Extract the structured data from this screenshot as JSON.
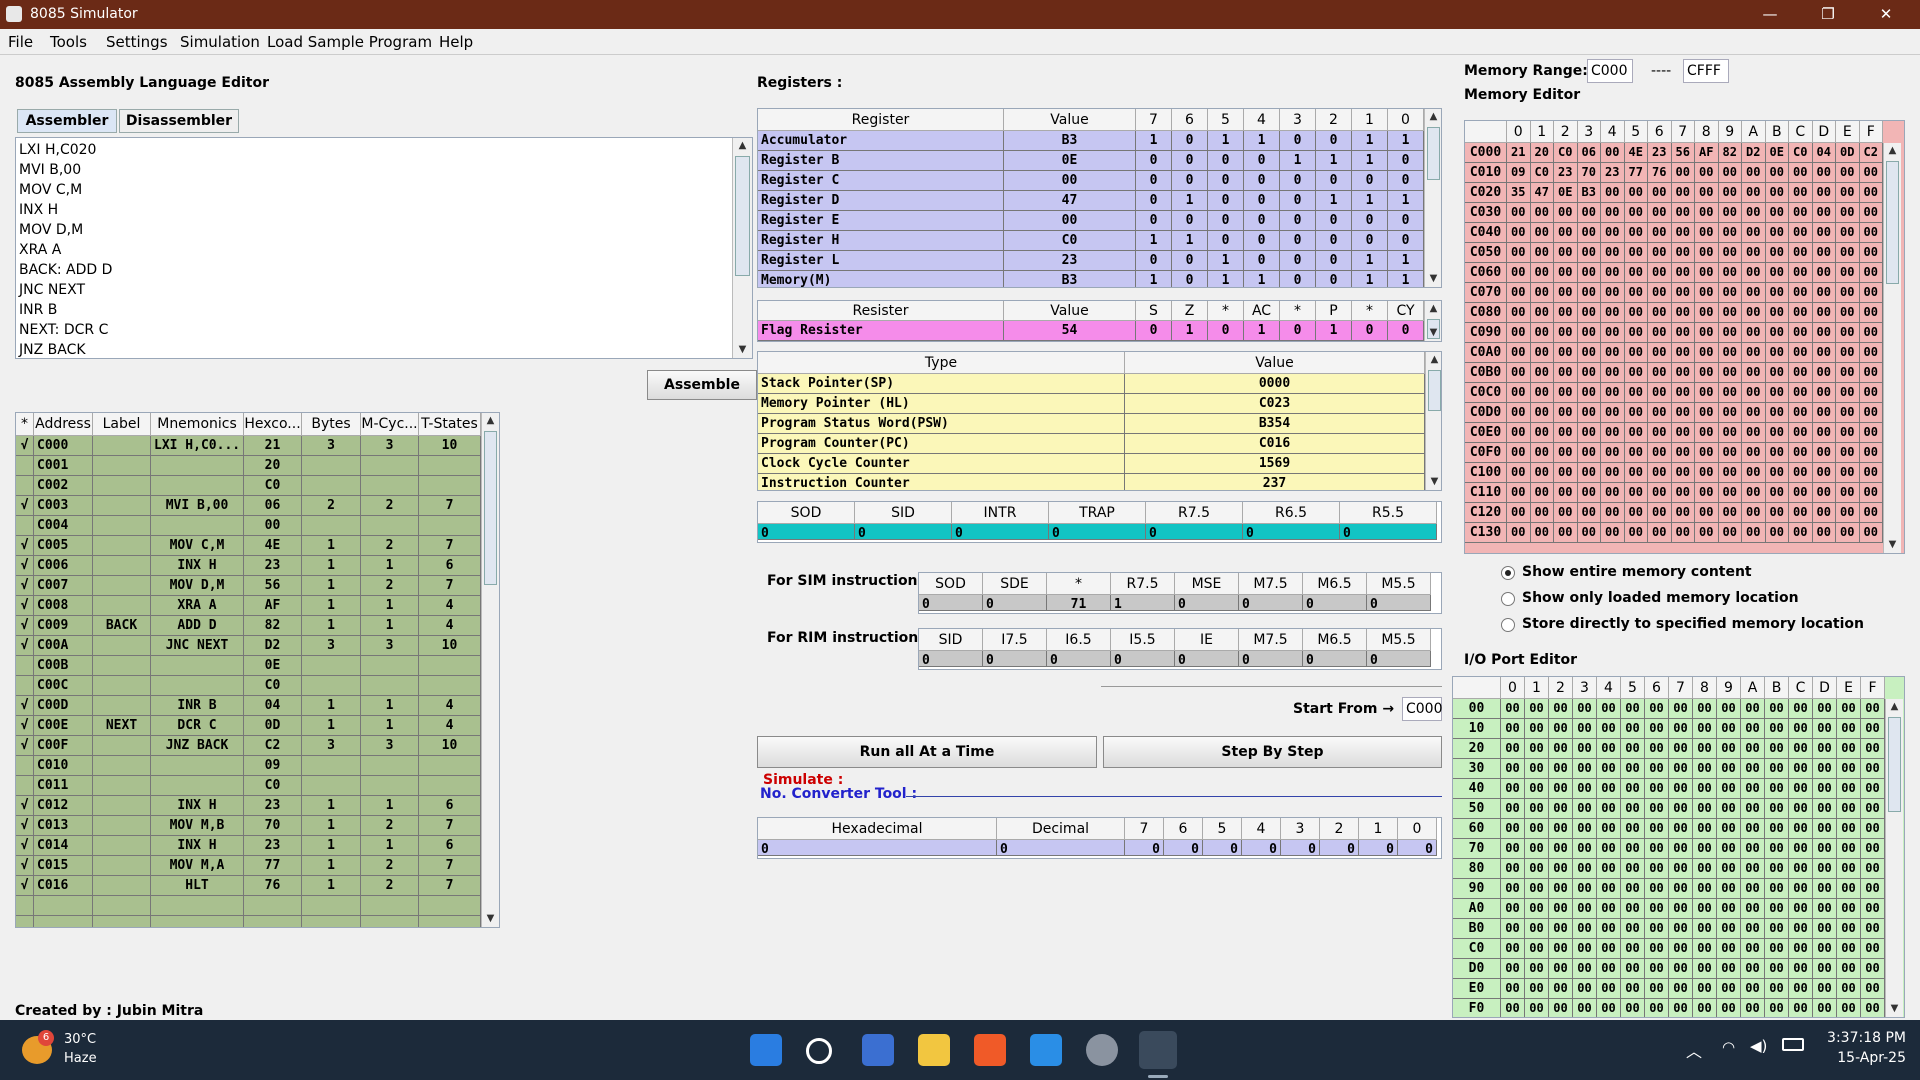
{
  "window": {
    "title": "8085 Simulator",
    "minimize": "—",
    "maximize": "❐",
    "close": "✕"
  },
  "menu": [
    "File",
    "Tools",
    "Settings",
    "Simulation",
    "Load Sample Program",
    "Help"
  ],
  "editor": {
    "title": "8085 Assembly Language Editor",
    "tabs": [
      "Assembler",
      "Disassembler"
    ],
    "lines": [
      "LXI H,C020",
      "MVI B,00",
      "MOV C,M",
      "INX H",
      "MOV D,M",
      "XRA A",
      "BACK: ADD D",
      "JNC NEXT",
      "INR B",
      "NEXT: DCR C",
      "JNZ BACK"
    ],
    "assemble_button": "Assemble"
  },
  "program_table": {
    "headers": [
      "*",
      "Address",
      "Label",
      "Mnemonics",
      "Hexco...",
      "Bytes",
      "M-Cyc...",
      "T-States"
    ],
    "rows": [
      [
        "√",
        "C000",
        "",
        "LXI H,C0...",
        "21",
        "3",
        "3",
        "10"
      ],
      [
        "",
        "C001",
        "",
        "",
        "20",
        "",
        "",
        ""
      ],
      [
        "",
        "C002",
        "",
        "",
        "C0",
        "",
        "",
        ""
      ],
      [
        "√",
        "C003",
        "",
        "MVI B,00",
        "06",
        "2",
        "2",
        "7"
      ],
      [
        "",
        "C004",
        "",
        "",
        "00",
        "",
        "",
        ""
      ],
      [
        "√",
        "C005",
        "",
        "MOV C,M",
        "4E",
        "1",
        "2",
        "7"
      ],
      [
        "√",
        "C006",
        "",
        "INX H",
        "23",
        "1",
        "1",
        "6"
      ],
      [
        "√",
        "C007",
        "",
        "MOV D,M",
        "56",
        "1",
        "2",
        "7"
      ],
      [
        "√",
        "C008",
        "",
        "XRA A",
        "AF",
        "1",
        "1",
        "4"
      ],
      [
        "√",
        "C009",
        "BACK",
        "ADD D",
        "82",
        "1",
        "1",
        "4"
      ],
      [
        "√",
        "C00A",
        "",
        "JNC NEXT",
        "D2",
        "3",
        "3",
        "10"
      ],
      [
        "",
        "C00B",
        "",
        "",
        "0E",
        "",
        "",
        ""
      ],
      [
        "",
        "C00C",
        "",
        "",
        "C0",
        "",
        "",
        ""
      ],
      [
        "√",
        "C00D",
        "",
        "INR B",
        "04",
        "1",
        "1",
        "4"
      ],
      [
        "√",
        "C00E",
        "NEXT",
        "DCR C",
        "0D",
        "1",
        "1",
        "4"
      ],
      [
        "√",
        "C00F",
        "",
        "JNZ BACK",
        "C2",
        "3",
        "3",
        "10"
      ],
      [
        "",
        "C010",
        "",
        "",
        "09",
        "",
        "",
        ""
      ],
      [
        "",
        "C011",
        "",
        "",
        "C0",
        "",
        "",
        ""
      ],
      [
        "√",
        "C012",
        "",
        "INX H",
        "23",
        "1",
        "1",
        "6"
      ],
      [
        "√",
        "C013",
        "",
        "MOV M,B",
        "70",
        "1",
        "2",
        "7"
      ],
      [
        "√",
        "C014",
        "",
        "INX H",
        "23",
        "1",
        "1",
        "6"
      ],
      [
        "√",
        "C015",
        "",
        "MOV M,A",
        "77",
        "1",
        "2",
        "7"
      ],
      [
        "√",
        "C016",
        "",
        "HLT",
        "76",
        "1",
        "2",
        "7"
      ],
      [
        "",
        "",
        "",
        "",
        "",
        "",
        "",
        ""
      ],
      [
        "",
        "",
        "",
        "",
        "",
        "",
        "",
        ""
      ]
    ]
  },
  "credit": "Created by : Jubin Mitra",
  "registers": {
    "title": "Registers :",
    "headers": [
      "Register",
      "Value",
      "7",
      "6",
      "5",
      "4",
      "3",
      "2",
      "1",
      "0"
    ],
    "rows": [
      [
        "Accumulator",
        "B3",
        "1",
        "0",
        "1",
        "1",
        "0",
        "0",
        "1",
        "1"
      ],
      [
        "Register B",
        "0E",
        "0",
        "0",
        "0",
        "0",
        "1",
        "1",
        "1",
        "0"
      ],
      [
        "Register C",
        "00",
        "0",
        "0",
        "0",
        "0",
        "0",
        "0",
        "0",
        "0"
      ],
      [
        "Register D",
        "47",
        "0",
        "1",
        "0",
        "0",
        "0",
        "1",
        "1",
        "1"
      ],
      [
        "Register E",
        "00",
        "0",
        "0",
        "0",
        "0",
        "0",
        "0",
        "0",
        "0"
      ],
      [
        "Register H",
        "C0",
        "1",
        "1",
        "0",
        "0",
        "0",
        "0",
        "0",
        "0"
      ],
      [
        "Register L",
        "23",
        "0",
        "0",
        "1",
        "0",
        "0",
        "0",
        "1",
        "1"
      ],
      [
        "Memory(M)",
        "B3",
        "1",
        "0",
        "1",
        "1",
        "0",
        "0",
        "1",
        "1"
      ]
    ]
  },
  "flags": {
    "headers": [
      "Resister",
      "Value",
      "S",
      "Z",
      "*",
      "AC",
      "*",
      "P",
      "*",
      "CY"
    ],
    "row": [
      "Flag Resister",
      "54",
      "0",
      "1",
      "0",
      "1",
      "0",
      "1",
      "0",
      "0"
    ]
  },
  "pointers": {
    "headers": [
      "Type",
      "Value"
    ],
    "rows": [
      [
        "Stack Pointer(SP)",
        "0000"
      ],
      [
        "Memory Pointer (HL)",
        "C023"
      ],
      [
        "Program Status Word(PSW)",
        "B354"
      ],
      [
        "Program Counter(PC)",
        "C016"
      ],
      [
        "Clock Cycle Counter",
        "1569"
      ],
      [
        "Instruction Counter",
        "237"
      ]
    ]
  },
  "interrupts": {
    "headers": [
      "SOD",
      "SID",
      "INTR",
      "TRAP",
      "R7.5",
      "R6.5",
      "R5.5"
    ],
    "values": [
      "0",
      "0",
      "0",
      "0",
      "0",
      "0",
      "0"
    ]
  },
  "sim": {
    "label": "For SIM instruction",
    "headers": [
      "SOD",
      "SDE",
      "*",
      "R7.5",
      "MSE",
      "M7.5",
      "M6.5",
      "M5.5"
    ],
    "values": [
      "0",
      "0",
      "71",
      "1",
      "0",
      "0",
      "0",
      "0"
    ]
  },
  "rim": {
    "label": "For RIM instruction",
    "headers": [
      "SID",
      "I7.5",
      "I6.5",
      "I5.5",
      "IE",
      "M7.5",
      "M6.5",
      "M5.5"
    ],
    "values": [
      "0",
      "0",
      "0",
      "0",
      "0",
      "0",
      "0",
      "0"
    ]
  },
  "start_from": {
    "label": "Start From →",
    "value": "C000"
  },
  "buttons": {
    "run_all": "Run all At a Time",
    "step": "Step By Step"
  },
  "simulate_label": "Simulate :",
  "converter": {
    "label": "No. Converter Tool :",
    "headers": [
      "Hexadecimal",
      "Decimal",
      "7",
      "6",
      "5",
      "4",
      "3",
      "2",
      "1",
      "0"
    ],
    "values": [
      "0",
      "0",
      "0",
      "0",
      "0",
      "0",
      "0",
      "0",
      "0",
      "0"
    ]
  },
  "memory": {
    "range_label": "Memory Range:",
    "range_from": "C000",
    "range_sep": "----",
    "range_to": "CFFF",
    "title": "Memory Editor",
    "col_headers": [
      "0",
      "1",
      "2",
      "3",
      "4",
      "5",
      "6",
      "7",
      "8",
      "9",
      "A",
      "B",
      "C",
      "D",
      "E",
      "F"
    ],
    "rows": [
      {
        "addr": "C000",
        "vals": [
          "21",
          "20",
          "C0",
          "06",
          "00",
          "4E",
          "23",
          "56",
          "AF",
          "82",
          "D2",
          "0E",
          "C0",
          "04",
          "0D",
          "C2"
        ]
      },
      {
        "addr": "C010",
        "vals": [
          "09",
          "C0",
          "23",
          "70",
          "23",
          "77",
          "76",
          "00",
          "00",
          "00",
          "00",
          "00",
          "00",
          "00",
          "00",
          "00"
        ]
      },
      {
        "addr": "C020",
        "vals": [
          "35",
          "47",
          "0E",
          "B3",
          "00",
          "00",
          "00",
          "00",
          "00",
          "00",
          "00",
          "00",
          "00",
          "00",
          "00",
          "00"
        ]
      },
      {
        "addr": "C030",
        "vals": []
      },
      {
        "addr": "C040",
        "vals": []
      },
      {
        "addr": "C050",
        "vals": []
      },
      {
        "addr": "C060",
        "vals": []
      },
      {
        "addr": "C070",
        "vals": []
      },
      {
        "addr": "C080",
        "vals": []
      },
      {
        "addr": "C090",
        "vals": []
      },
      {
        "addr": "C0A0",
        "vals": []
      },
      {
        "addr": "C0B0",
        "vals": []
      },
      {
        "addr": "C0C0",
        "vals": []
      },
      {
        "addr": "C0D0",
        "vals": []
      },
      {
        "addr": "C0E0",
        "vals": []
      },
      {
        "addr": "C0F0",
        "vals": []
      },
      {
        "addr": "C100",
        "vals": []
      },
      {
        "addr": "C110",
        "vals": []
      },
      {
        "addr": "C120",
        "vals": []
      },
      {
        "addr": "C130",
        "vals": []
      }
    ]
  },
  "memory_options": [
    "Show entire memory content",
    "Show only loaded memory location",
    "Store directly to specified memory location"
  ],
  "io": {
    "title": "I/O Port Editor",
    "col_headers": [
      "0",
      "1",
      "2",
      "3",
      "4",
      "5",
      "6",
      "7",
      "8",
      "9",
      "A",
      "B",
      "C",
      "D",
      "E",
      "F"
    ],
    "rows": [
      "00",
      "10",
      "20",
      "30",
      "40",
      "50",
      "60",
      "70",
      "80",
      "90",
      "A0",
      "B0",
      "C0",
      "D0",
      "E0",
      "F0"
    ],
    "fill": "00"
  },
  "taskbar": {
    "temp": "30°C",
    "weather": "Haze",
    "badge": "6",
    "time": "3:37:18 PM",
    "date": "15-Apr-25"
  },
  "colors": {
    "program_bg": "#a9c08f",
    "register_bg": "#c6c6f2",
    "flag_bg": "#f58cea",
    "pointer_bg": "#fbf7b9",
    "interrupt_bg": "#11c4c4",
    "memory_bg": "#f2b5b5",
    "io_bg": "#c8f0c0"
  }
}
